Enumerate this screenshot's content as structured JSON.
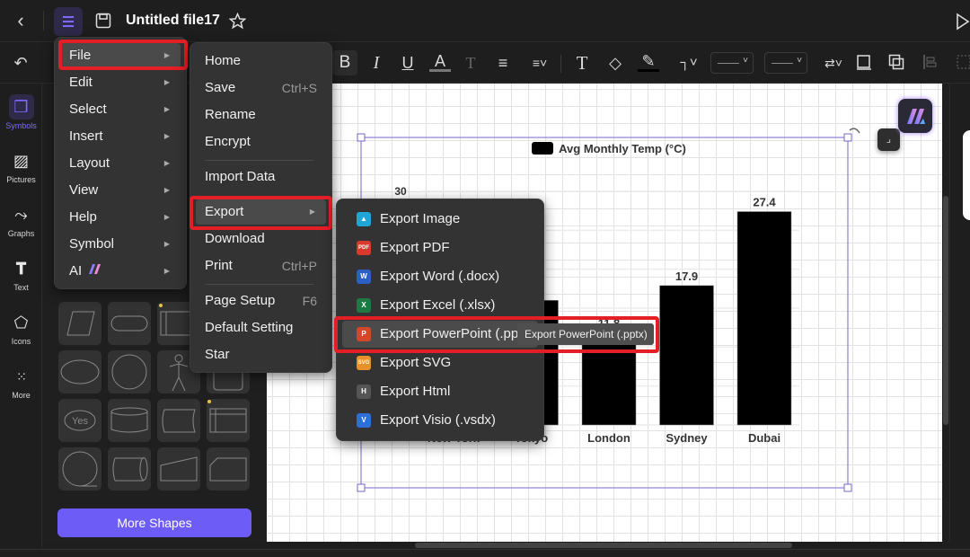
{
  "header": {
    "title": "Untitled file17"
  },
  "toolbar": {
    "bold": "B",
    "italic": "I",
    "underline": "U",
    "font_color": "A",
    "text_style": "T",
    "text_tool": "T"
  },
  "rail": {
    "items": [
      {
        "label": "Symbols",
        "icon": "symbols-icon",
        "active": true
      },
      {
        "label": "Pictures",
        "icon": "picture-icon"
      },
      {
        "label": "Graphs",
        "icon": "graph-icon"
      },
      {
        "label": "Text",
        "icon": "text-icon"
      },
      {
        "label": "Icons",
        "icon": "pentagon-icon"
      },
      {
        "label": "More",
        "icon": "grid-dots-icon"
      }
    ]
  },
  "panel": {
    "shape_yes_label": "Yes",
    "more_shapes": "More Shapes"
  },
  "main_menu": {
    "items": [
      {
        "label": "File",
        "submenu": true,
        "highlighted": true
      },
      {
        "label": "Edit",
        "submenu": true
      },
      {
        "label": "Select",
        "submenu": true
      },
      {
        "label": "Insert",
        "submenu": true
      },
      {
        "label": "Layout",
        "submenu": true
      },
      {
        "label": "View",
        "submenu": true
      },
      {
        "label": "Help",
        "submenu": true
      },
      {
        "label": "Symbol",
        "submenu": true
      },
      {
        "label": "AI",
        "submenu": true
      }
    ]
  },
  "file_menu": {
    "items": [
      {
        "label": "Home"
      },
      {
        "label": "Save",
        "shortcut": "Ctrl+S"
      },
      {
        "label": "Rename"
      },
      {
        "label": "Encrypt"
      },
      {
        "label": "Import Data"
      },
      {
        "label": "Export",
        "submenu": true,
        "highlighted": true
      },
      {
        "label": "Download"
      },
      {
        "label": "Print",
        "shortcut": "Ctrl+P"
      },
      {
        "label": "Page Setup",
        "shortcut": "F6"
      },
      {
        "label": "Default Setting"
      },
      {
        "label": "Star"
      }
    ]
  },
  "export_menu": {
    "items": [
      {
        "label": "Export Image",
        "badge": "",
        "color": "#1fa6d6"
      },
      {
        "label": "Export PDF",
        "badge": "PDF",
        "color": "#d8392b"
      },
      {
        "label": "Export Word (.docx)",
        "badge": "W",
        "color": "#2b5fc4"
      },
      {
        "label": "Export Excel (.xlsx)",
        "badge": "X",
        "color": "#1e7a45"
      },
      {
        "label": "Export PowerPoint (.pptx)",
        "badge": "P",
        "color": "#d1482a",
        "highlighted": true
      },
      {
        "label": "Export SVG",
        "badge": "SVG",
        "color": "#e8902a"
      },
      {
        "label": "Export Html",
        "badge": "H",
        "color": "#555555"
      },
      {
        "label": "Export Visio (.vsdx)",
        "badge": "V",
        "color": "#2d6fd8"
      }
    ],
    "tooltip": "Export PowerPoint (.pptx)"
  },
  "colors": {
    "accent": "#6e5cf6",
    "highlight_box": "#e41e26",
    "selection": "#7b64c8"
  },
  "chart_data": {
    "type": "bar",
    "title": "Avg Monthly Temp (°C)",
    "categories": [
      "New York",
      "Tokyo",
      "London",
      "Sydney",
      "Dubai"
    ],
    "values": [
      null,
      16.0,
      11.8,
      17.9,
      27.4
    ],
    "value_labels": [
      "",
      "",
      "11.8",
      "17.9",
      "27.4"
    ],
    "y_ticks": [
      30
    ],
    "ylim": [
      0,
      30
    ],
    "xlabel": "",
    "ylabel": "",
    "bar_color": "#000000",
    "grid": true,
    "legend": "top"
  }
}
